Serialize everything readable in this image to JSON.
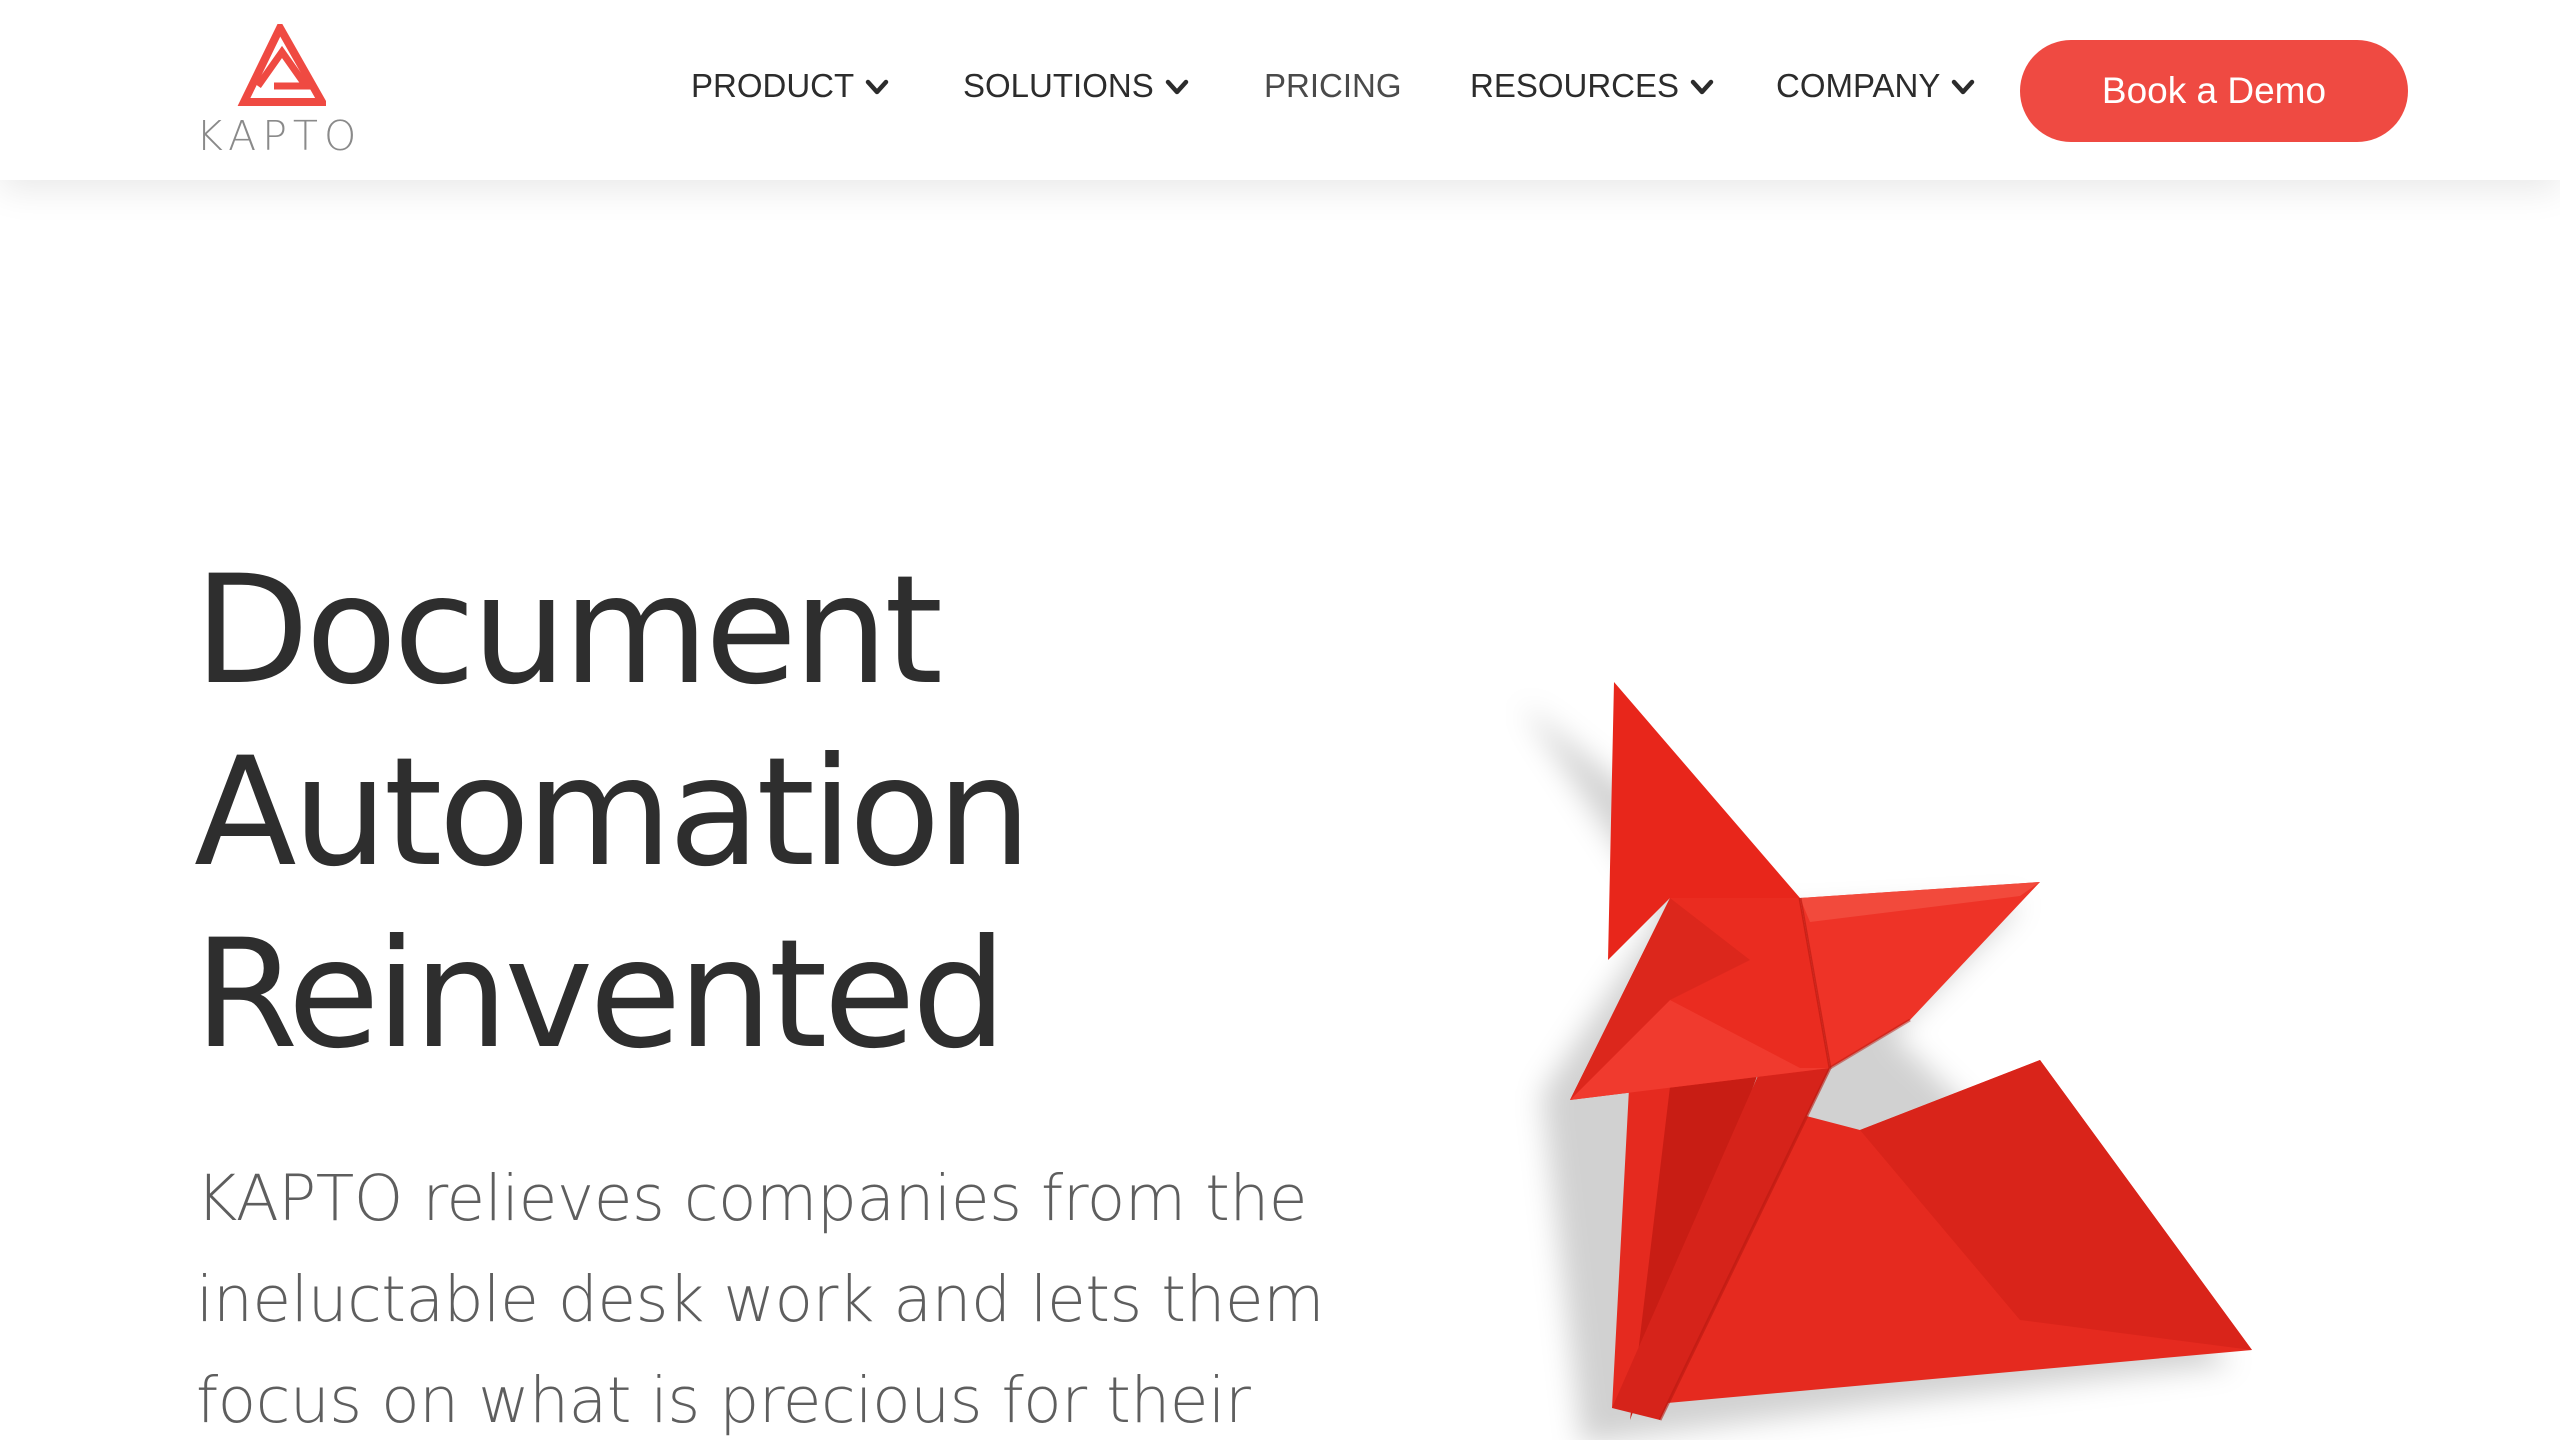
{
  "brand": {
    "name": "KAPTO",
    "logo_icon": "kapto-triangle-logo-icon",
    "accent_color": "#ef4a42"
  },
  "nav": {
    "items": [
      {
        "label": "PRODUCT",
        "has_dropdown": true
      },
      {
        "label": "SOLUTIONS",
        "has_dropdown": true
      },
      {
        "label": "PRICING",
        "has_dropdown": false
      },
      {
        "label": "RESOURCES",
        "has_dropdown": true
      },
      {
        "label": "COMPANY",
        "has_dropdown": true
      }
    ],
    "cta_label": "Book a Demo"
  },
  "hero": {
    "title_lines": [
      "Document",
      "Automation",
      "Reinvented"
    ],
    "subtitle_lines": [
      "KAPTO relieves companies from the",
      "ineluctable desk work and lets them",
      "focus on what is precious for their"
    ],
    "image": "red-origami-fox-illustration"
  }
}
